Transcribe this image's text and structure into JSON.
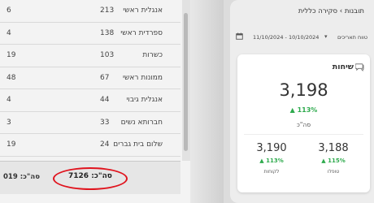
{
  "table": {
    "rows": [
      {
        "name": "אנגלית ראשי",
        "value": "213",
        "left": "6"
      },
      {
        "name": "ספרדית ראשי",
        "value": "138",
        "left": "4"
      },
      {
        "name": "כשרות",
        "value": "103",
        "left": "19"
      },
      {
        "name": "ממונות ראשי",
        "value": "67",
        "left": "48"
      },
      {
        "name": "אנגלית גיבוי",
        "value": "44",
        "left": "4"
      },
      {
        "name": "חברותא נשים",
        "value": "33",
        "left": "3"
      },
      {
        "name": "שלום בית גברים",
        "value": "24",
        "left": "19"
      }
    ],
    "footer_total": "סה\"כ: 7126",
    "footer_left": "סה\"כ: 019"
  },
  "dashboard": {
    "breadcrumb": "תובנות › סקירה כללית",
    "date_type": "טווח תאריכים",
    "date_range": "11/10/2024 - 10/10/2024",
    "card": {
      "title": "שיחות",
      "main_value": "3,198",
      "main_change": "▲ 113%",
      "main_label": "סה\"כ",
      "sub_right": {
        "value": "3,188",
        "change": "▲ 115%",
        "label": "טופלו"
      },
      "sub_left": {
        "value": "3,190",
        "change": "▲ 113%",
        "label": "לקוחות"
      }
    }
  },
  "colors": {
    "highlight_circle": "#e0141e",
    "positive_change": "#2eaa4d"
  }
}
